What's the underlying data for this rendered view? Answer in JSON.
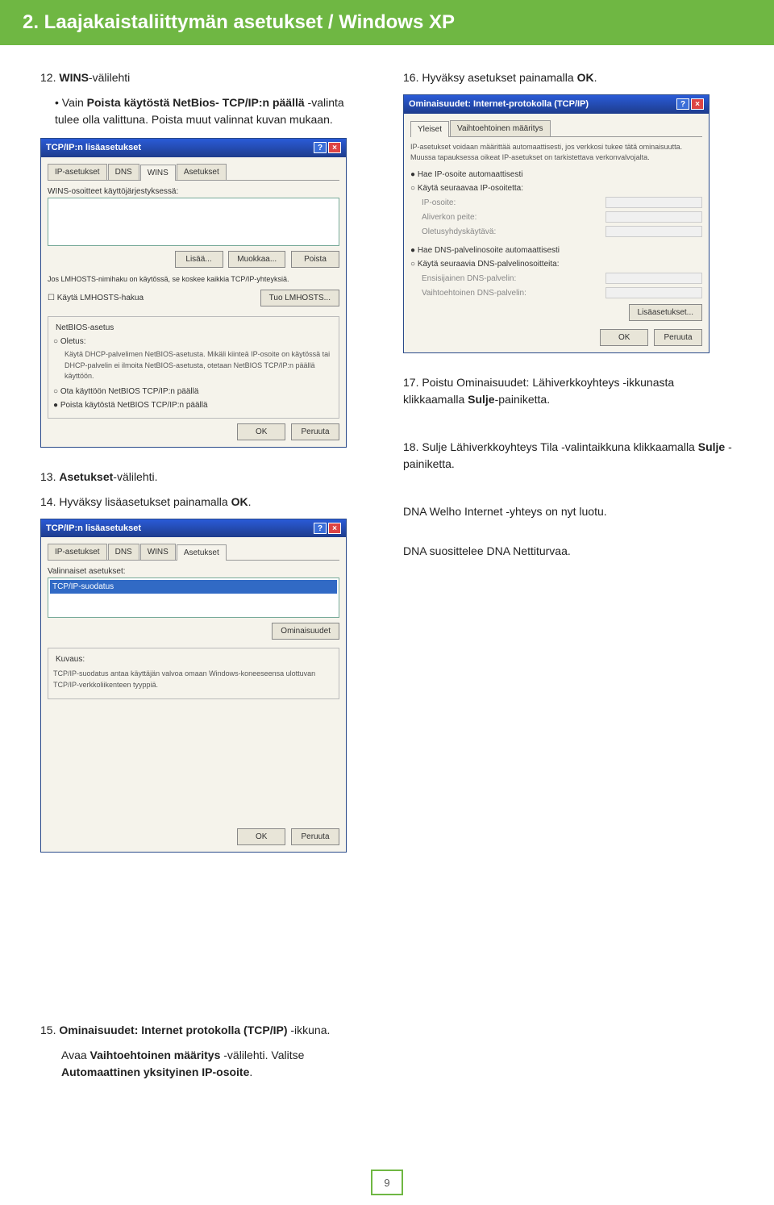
{
  "header": {
    "title": "2. Laajakaistaliittymän asetukset / Windows XP"
  },
  "left": {
    "step12_num": "12.",
    "step12_label_prefix": "WINS",
    "step12_label_suffix": "-välilehti",
    "step12_bullet_a": "Vain ",
    "step12_bullet_b": "Poista käytöstä NetBios- TCP/IP:n päällä",
    "step12_bullet_c": " -valinta tulee olla valittuna. Poista muut valinnat kuvan mukaan.",
    "dlg1_title": "TCP/IP:n lisäasetukset",
    "dlg1_tabs": [
      "IP-asetukset",
      "DNS",
      "WINS",
      "Asetukset"
    ],
    "dlg1_wins_label": "WINS-osoitteet käyttöjärjestyksessä:",
    "dlg1_btn_add": "Lisää...",
    "dlg1_btn_edit": "Muokkaa...",
    "dlg1_btn_del": "Poista",
    "dlg1_lmtxt": "Jos LMHOSTS-nimihaku on käytössä, se koskee kaikkia TCP/IP-yhteyksiä.",
    "dlg1_chk": "Käytä LMHOSTS-hakua",
    "dlg1_importbtn": "Tuo LMHOSTS...",
    "dlg1_group": "NetBIOS-asetus",
    "dlg1_r1": "Oletus:",
    "dlg1_r1_desc": "Käytä DHCP-palvelimen NetBIOS-asetusta. Mikäli kiinteä IP-osoite on käytössä tai DHCP-palvelin ei ilmoita NetBIOS-asetusta, otetaan NetBIOS TCP/IP:n päällä käyttöön.",
    "dlg1_r2": "Ota käyttöön NetBIOS TCP/IP:n päällä",
    "dlg1_r3": "Poista käytöstä NetBIOS TCP/IP:n päällä",
    "dlg1_ok": "OK",
    "dlg1_cancel": "Peruuta",
    "step13_num": "13.",
    "step13_a": "Asetukset",
    "step13_b": "-välilehti.",
    "step14_num": "14.",
    "step14_a": "Hyväksy lisäasetukset painamalla ",
    "step14_b": "OK",
    "step14_c": ".",
    "dlg2_label": "Valinnaiset asetukset:",
    "dlg2_item": "TCP/IP-suodatus",
    "dlg2_prop": "Ominaisuudet",
    "dlg2_group": "Kuvaus:",
    "dlg2_desc": "TCP/IP-suodatus antaa käyttäjän valvoa omaan Windows-koneeseensa ulottuvan TCP/IP-verkkoliikenteen tyyppiä.",
    "step15_num": "15.",
    "step15_a": "Ominaisuudet: Internet protokolla (TCP/IP)",
    "step15_b": " -ikkuna.",
    "step15_line2a": "Avaa ",
    "step15_line2b": "Vaihtoehtoinen määritys",
    "step15_line2c": " -välilehti. Valitse ",
    "step15_line2d": "Automaattinen yksityinen IP-osoite",
    "step15_line2e": "."
  },
  "right": {
    "step16_num": "16.",
    "step16_a": "Hyväksy asetukset painamalla ",
    "step16_b": "OK",
    "step16_c": ".",
    "dlg3_title": "Ominaisuudet: Internet-protokolla (TCP/IP)",
    "dlg3_tabs": [
      "Yleiset",
      "Vaihtoehtoinen määritys"
    ],
    "dlg3_intro": "IP-asetukset voidaan määrittää automaattisesti, jos verkkosi tukee tätä ominaisuutta. Muussa tapauksessa oikeat IP-asetukset on tarkistettava verkonvalvojalta.",
    "dlg3_r1": "Hae IP-osoite automaattisesti",
    "dlg3_r2": "Käytä seuraavaa IP-osoitetta:",
    "dlg3_ip": "IP-osoite:",
    "dlg3_mask": "Aliverkon peite:",
    "dlg3_gw": "Oletusyhdyskäytävä:",
    "dlg3_r3": "Hae DNS-palvelinosoite automaattisesti",
    "dlg3_r4": "Käytä seuraavia DNS-palvelinosoitteita:",
    "dlg3_dns1": "Ensisijainen DNS-palvelin:",
    "dlg3_dns2": "Vaihtoehtoinen DNS-palvelin:",
    "dlg3_adv": "Lisäasetukset...",
    "dlg3_ok": "OK",
    "dlg3_cancel": "Peruuta",
    "step17_num": "17.",
    "step17_a": "Poistu Ominaisuudet: Lähiverkkoyhteys -ikkunasta klikkaamalla ",
    "step17_b": "Sulje",
    "step17_c": "-painiketta.",
    "step18_num": "18.",
    "step18_a": "Sulje Lähiverkkoyhteys Tila -valintaikkuna klikkaamalla ",
    "step18_b": "Sulje",
    "step18_c": " -painiketta.",
    "note1": "DNA Welho Internet -yhteys on nyt luotu.",
    "note2": "DNA suosittelee DNA Nettiturvaa."
  },
  "page_number": "9"
}
